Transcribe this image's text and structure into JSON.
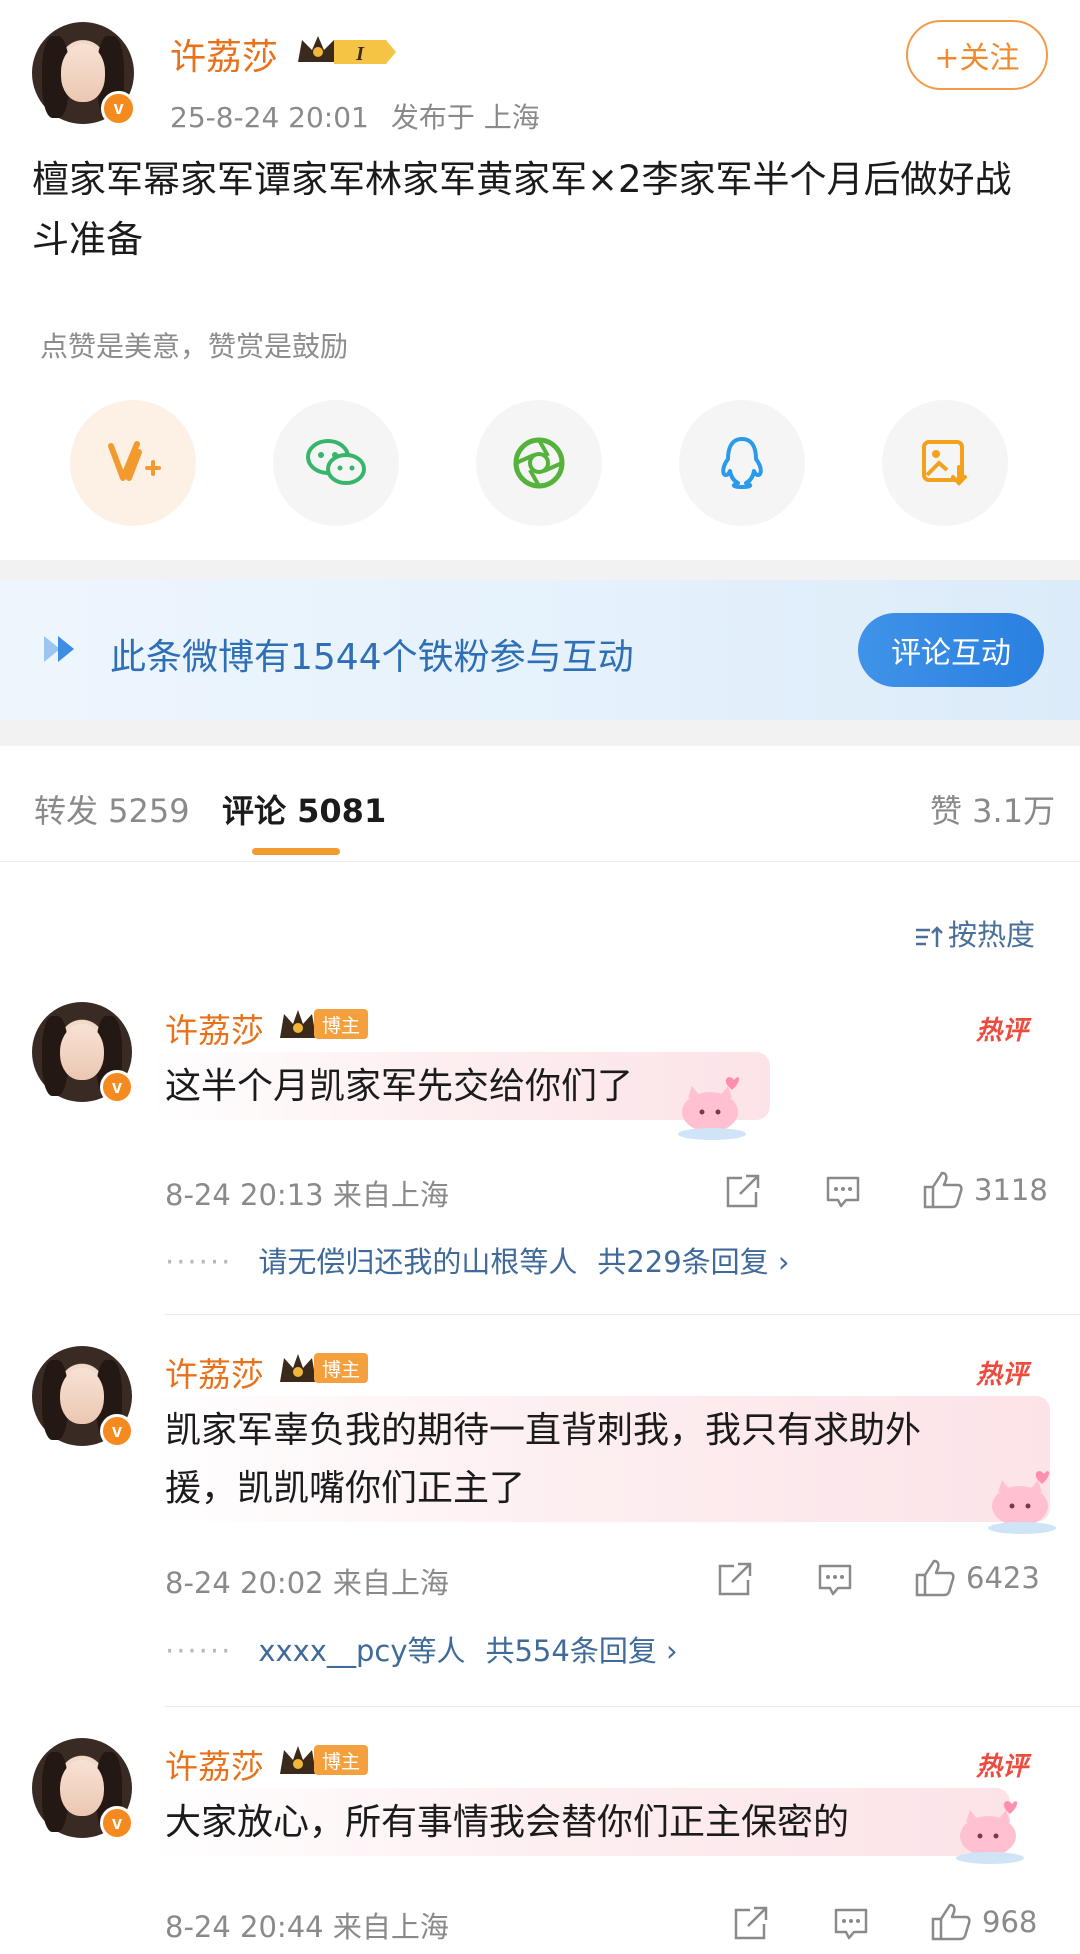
{
  "post": {
    "author": "许荔莎",
    "level_badge": "I",
    "timestamp": "25-8-24 20:01",
    "location": "发布于 上海",
    "follow_label": "+关注",
    "text": "檀家军幂家军谭家军林家军黄家军×2李家军半个月后做好战斗准备",
    "reward_tip": "点赞是美意，赞赏是鼓励",
    "share_icons": [
      "reward-v-icon",
      "wechat-icon",
      "moments-icon",
      "qq-icon",
      "save-image-icon"
    ]
  },
  "fans_banner": {
    "text": "此条微博有1544个铁粉参与互动",
    "button": "评论互动"
  },
  "tabs": {
    "repost": "转发 5259",
    "comments": "评论 5081",
    "likes": "赞 3.1万"
  },
  "sort_label": "按热度",
  "comments": [
    {
      "author": "许荔莎",
      "badge": "博主",
      "hot": "热评",
      "text": "这半个月凯家军先交给你们了",
      "time": "8-24 20:13 来自上海",
      "likes": "3118",
      "reply_preview": "请无偿归还我的山根等人",
      "reply_total": "共229条回复 ›"
    },
    {
      "author": "许荔莎",
      "badge": "博主",
      "hot": "热评",
      "text_line1": "凯家军辜负我的期待一直背刺我，我只有求助外",
      "text_line2": "援，凯凯嘴你们正主了",
      "time": "8-24 20:02 来自上海",
      "likes": "6423",
      "reply_preview": "xxxx__pcy等人",
      "reply_total": "共554条回复 ›"
    },
    {
      "author": "许荔莎",
      "badge": "博主",
      "hot": "热评",
      "text": "大家放心，所有事情我会替你们正主保密的",
      "time": "8-24 20:44 来自上海",
      "likes": "968"
    }
  ],
  "colors": {
    "accent_orange": "#e8711c",
    "link_blue": "#3f6a99",
    "hot_red": "#ef4a3e",
    "banner_blue": "#2f6fb5"
  }
}
